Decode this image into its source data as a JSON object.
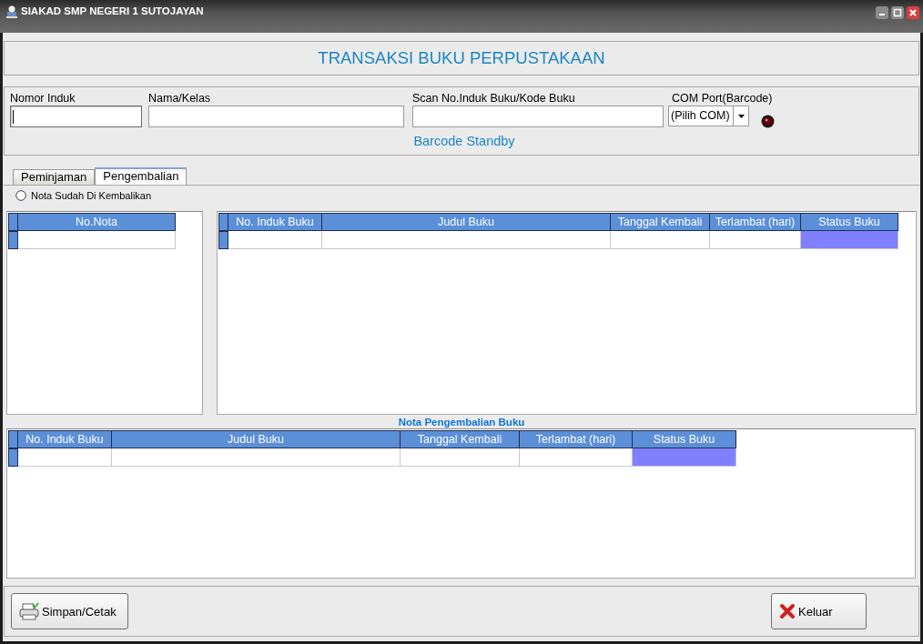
{
  "window": {
    "title": "SIAKAD SMP NEGERI 1 SUTOJAYAN"
  },
  "header": {
    "title": "TRANSAKSI BUKU PERPUSTAKAAN"
  },
  "fields": [
    {
      "label": "Nomor Induk",
      "focused": true
    },
    {
      "label": "Nama/Kelas",
      "focused": false
    },
    {
      "label": "Scan No.Induk Buku/Kode Buku",
      "focused": false
    }
  ],
  "com_port": {
    "label": "COM Port(Barcode)",
    "value": "(Pilih COM)",
    "connected": false
  },
  "barcode_status": "Barcode Standby",
  "tabs": [
    {
      "label": "Peminjaman",
      "selected": false
    },
    {
      "label": "Pengembalian",
      "selected": true
    }
  ],
  "radio": {
    "label": "Nota Sudah Di Kembalikan",
    "checked": false
  },
  "nota_table": {
    "columns": [
      {
        "label": "No.Nota",
        "highlighted": false
      }
    ]
  },
  "book_table": {
    "columns": [
      {
        "label": "No. Induk Buku",
        "highlighted": false
      },
      {
        "label": "Judul Buku",
        "highlighted": false
      },
      {
        "label": "Tanggal Kembali",
        "highlighted": false
      },
      {
        "label": "Terlambat (hari)",
        "highlighted": false
      },
      {
        "label": "Status Buku",
        "highlighted": true
      }
    ]
  },
  "return_section": {
    "title": "Nota Pengembalian Buku"
  },
  "return_table": {
    "columns": [
      {
        "label": "No. Induk Buku",
        "highlighted": false
      },
      {
        "label": "Judul Buku",
        "highlighted": false
      },
      {
        "label": "Tanggal Kembali",
        "highlighted": false
      },
      {
        "label": "Terlambat (hari)",
        "highlighted": false
      },
      {
        "label": "Status Buku",
        "highlighted": true
      }
    ]
  },
  "buttons": [
    {
      "label": "Simpan/Cetak",
      "kind": "print"
    },
    {
      "label": "Keluar",
      "kind": "exit"
    }
  ]
}
